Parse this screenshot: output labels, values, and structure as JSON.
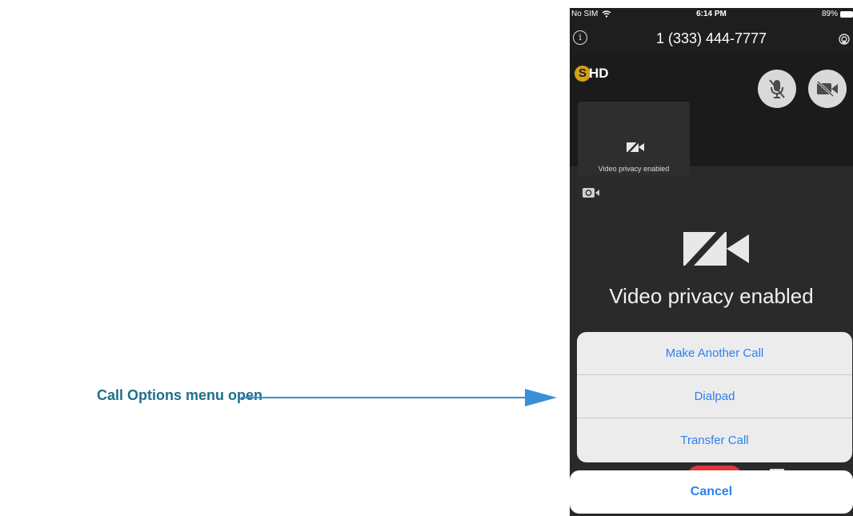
{
  "callout": {
    "label": "Call Options menu open"
  },
  "status_bar": {
    "carrier": "No SIM",
    "time": "6:14 PM",
    "battery": "89%"
  },
  "call": {
    "phone_number": "1 (333) 444-7777"
  },
  "self_view": {
    "label": "Video privacy enabled"
  },
  "main_video": {
    "label": "Video privacy enabled"
  },
  "call_options": {
    "items": [
      {
        "label": "Make Another Call"
      },
      {
        "label": "Dialpad"
      },
      {
        "label": "Transfer Call"
      }
    ],
    "cancel_label": "Cancel"
  },
  "colors": {
    "callout_text": "#1f6f8b",
    "arrow": "#3a8fd9",
    "action_text": "#2f80ed",
    "logo_gold": "#d4a017",
    "hangup_red": "#e0363e"
  }
}
